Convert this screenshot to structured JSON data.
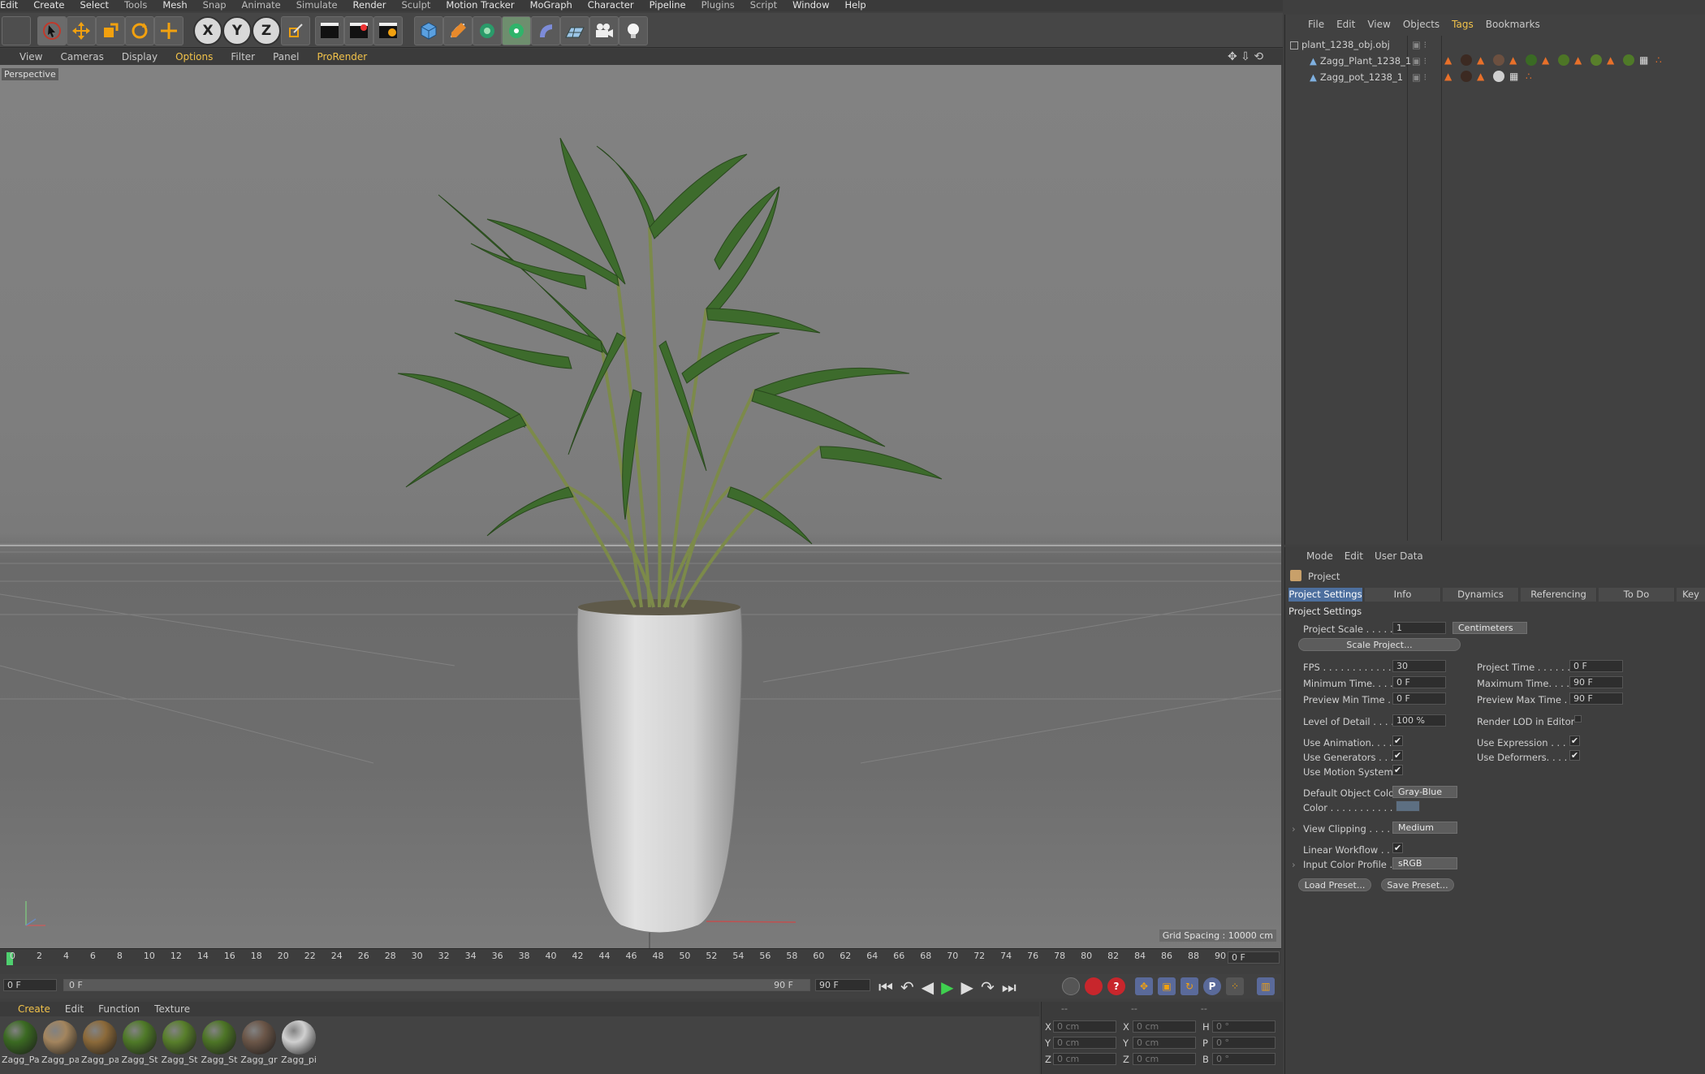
{
  "menubar": [
    "Edit",
    "Create",
    "Select",
    "Tools",
    "Mesh",
    "Snap",
    "Animate",
    "Simulate",
    "Render",
    "Sculpt",
    "Motion Tracker",
    "MoGraph",
    "Character",
    "Pipeline",
    "Plugins",
    "Script",
    "Window",
    "Help"
  ],
  "viewport_menu": [
    "View",
    "Cameras",
    "Display",
    "Options",
    "Filter",
    "Panel",
    "ProRender"
  ],
  "viewport": {
    "label": "Perspective",
    "grid_spacing": "Grid Spacing : 10000 cm"
  },
  "toolbar": {
    "x": "X",
    "y": "Y",
    "z": "Z"
  },
  "timeline": {
    "ticks": [
      "0",
      "2",
      "4",
      "6",
      "8",
      "10",
      "12",
      "14",
      "16",
      "18",
      "20",
      "22",
      "24",
      "26",
      "28",
      "30",
      "32",
      "34",
      "36",
      "38",
      "40",
      "42",
      "44",
      "46",
      "48",
      "50",
      "52",
      "54",
      "56",
      "58",
      "60",
      "62",
      "64",
      "66",
      "68",
      "70",
      "72",
      "74",
      "76",
      "78",
      "80",
      "82",
      "84",
      "86",
      "88",
      "90"
    ],
    "current_frame": "0 F"
  },
  "playbar": {
    "start": "0 F",
    "range_start": "0 F",
    "range_end": "90 F",
    "end": "90 F"
  },
  "material_menu": [
    "Create",
    "Edit",
    "Function",
    "Texture"
  ],
  "materials": [
    {
      "label": "Zagg_Pa",
      "color": "#3b6a22"
    },
    {
      "label": "Zagg_pa",
      "color": "#a3855e"
    },
    {
      "label": "Zagg_pa",
      "color": "#8c6a3a"
    },
    {
      "label": "Zagg_St",
      "color": "#4f7a28"
    },
    {
      "label": "Zagg_St",
      "color": "#587f2b"
    },
    {
      "label": "Zagg_St",
      "color": "#4d7526"
    },
    {
      "label": "Zagg_gr",
      "color": "#6b5648"
    },
    {
      "label": "Zagg_pi",
      "color": "#d0d0d0"
    }
  ],
  "coords": {
    "header": [
      "--",
      "--",
      "--"
    ],
    "rows": [
      {
        "a": "X",
        "av": "0 cm",
        "b": "X",
        "bv": "0 cm",
        "c": "H",
        "cv": "0 °"
      },
      {
        "a": "Y",
        "av": "0 cm",
        "b": "Y",
        "bv": "0 cm",
        "c": "P",
        "cv": "0 °"
      },
      {
        "a": "Z",
        "av": "0 cm",
        "b": "Z",
        "bv": "0 cm",
        "c": "B",
        "cv": "0 °"
      }
    ]
  },
  "objects_menu": [
    "File",
    "Edit",
    "View",
    "Objects",
    "Tags",
    "Bookmarks"
  ],
  "objects": [
    "plant_1238_obj.obj",
    "Zagg_Plant_1238_1",
    "Zagg_pot_1238_1"
  ],
  "attributes": {
    "menu": [
      "Mode",
      "Edit",
      "User Data"
    ],
    "title": "Project",
    "tabs": [
      "Project Settings",
      "Info",
      "Dynamics",
      "Referencing",
      "To Do",
      "Key In"
    ],
    "section": "Project Settings",
    "project_scale_label": "Project Scale . . . . . .",
    "project_scale": "1",
    "scale_unit": "Centimeters",
    "scale_button": "Scale Project...",
    "fps_label": "FPS . . . . . . . . . . . . . .",
    "fps": "30",
    "project_time_label": "Project Time . . . . . . . .",
    "project_time": "0 F",
    "min_time_label": "Minimum Time. . . . . .",
    "min_time": "0 F",
    "max_time_label": "Maximum Time. . . . . .",
    "max_time": "90 F",
    "prev_min_label": "Preview Min Time . . .",
    "prev_min": "0 F",
    "prev_max_label": "Preview Max Time . . .",
    "prev_max": "90 F",
    "lod_label": "Level of Detail . . . . .",
    "lod": "100 %",
    "render_lod_label": "Render LOD in Editor",
    "use_anim_label": "Use Animation. . . . .",
    "use_expr_label": "Use Expression . . . . .",
    "use_gen_label": "Use Generators . . . .",
    "use_def_label": "Use Deformers. . . . . .",
    "use_motion_label": "Use Motion System",
    "obj_color_label": "Default Object Color",
    "obj_color": "Gray-Blue",
    "color_label": "Color . . . . . . . . . . .",
    "view_clip_label": "View Clipping . . . . . .",
    "view_clip": "Medium",
    "linear_label": "Linear Workflow . . .",
    "input_profile_label": "Input Color Profile . .",
    "input_profile": "sRGB",
    "load_preset": "Load Preset...",
    "save_preset": "Save Preset..."
  }
}
